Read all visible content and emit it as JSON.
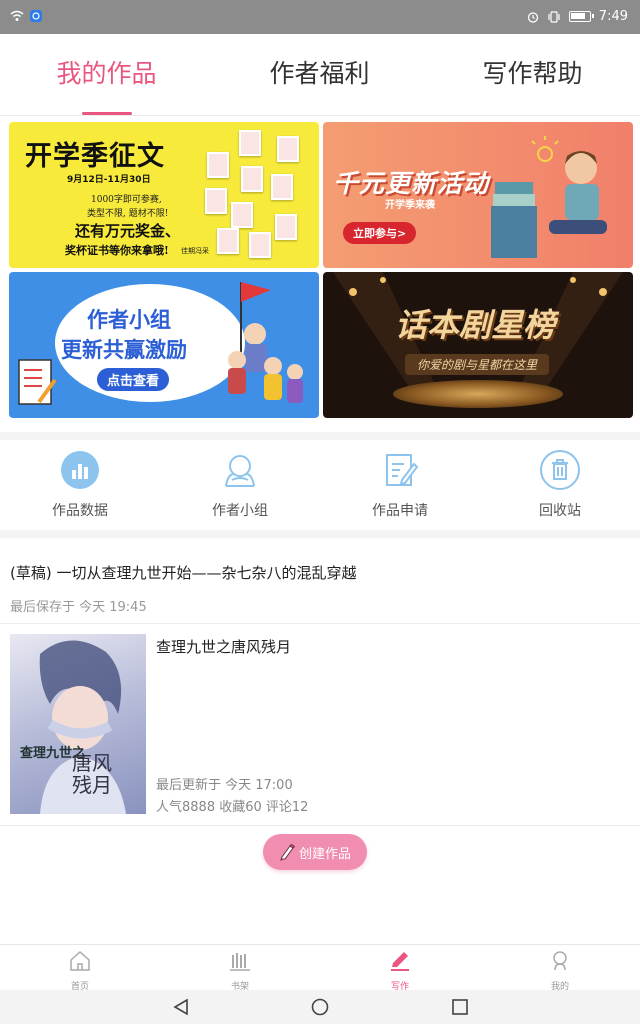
{
  "status_bar": {
    "time": "7:49"
  },
  "top_tabs": [
    {
      "label": "我的作品",
      "active": true
    },
    {
      "label": "作者福利",
      "active": false
    },
    {
      "label": "写作帮助",
      "active": false
    }
  ],
  "banners": {
    "b1": {
      "title": "开学季征文",
      "date": "9月12日-11月30日",
      "line1": "1000字即可参赛,",
      "line2": "类型不限, 题材不限!",
      "line3": "还有万元奖金、",
      "line4": "奖杯证书等你来拿哦!",
      "logo": "佳期冯采"
    },
    "b2": {
      "title": "千元更新活动",
      "subtitle": "开学季来袭",
      "button": "立即参与>"
    },
    "b3": {
      "line1": "作者小组",
      "line2": "更新共赢激励",
      "button": "点击查看"
    },
    "b4": {
      "title": "话本剧星榜",
      "subtitle": "你爱的剧与星都在这里"
    }
  },
  "quick_actions": [
    {
      "label": "作品数据",
      "icon": "bar-chart-icon"
    },
    {
      "label": "作者小组",
      "icon": "group-icon"
    },
    {
      "label": "作品申请",
      "icon": "edit-document-icon"
    },
    {
      "label": "回收站",
      "icon": "trash-icon"
    }
  ],
  "draft": {
    "title": "(草稿) 一切从查理九世开始——杂七杂八的混乱穿越",
    "saved": "最后保存于 今天 19:45"
  },
  "work": {
    "title": "查理九世之唐风残月",
    "cover_text1": "查理九世之",
    "cover_text2": "唐风\n残月",
    "updated": "最后更新于 今天 17:00",
    "stats": "人气8888 收藏60 评论12"
  },
  "create_button": {
    "label": "创建作品"
  },
  "bottom_nav": [
    {
      "label": "首页",
      "icon": "home-icon",
      "active": false
    },
    {
      "label": "书架",
      "icon": "bookshelf-icon",
      "active": false
    },
    {
      "label": "写作",
      "icon": "pencil-icon",
      "active": true
    },
    {
      "label": "我的",
      "icon": "profile-icon",
      "active": false
    }
  ],
  "colors": {
    "accent": "#e9577f",
    "icon_blue": "#6ab0e8"
  }
}
